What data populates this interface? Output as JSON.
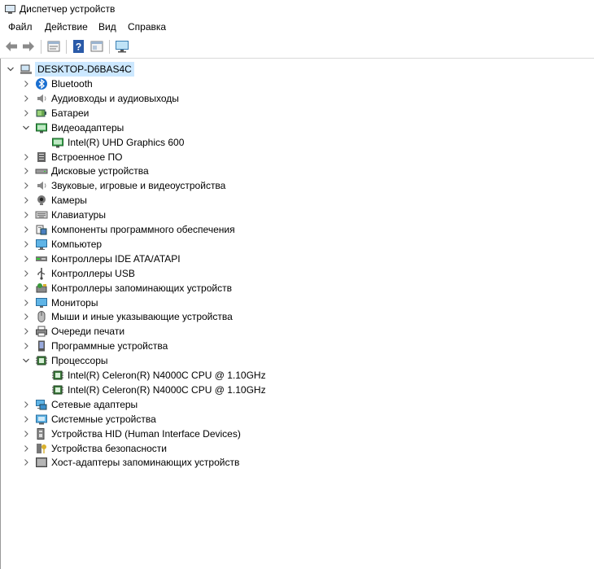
{
  "window": {
    "title": "Диспетчер устройств"
  },
  "menu": {
    "items": [
      "Файл",
      "Действие",
      "Вид",
      "Справка"
    ]
  },
  "toolbar": {
    "buttons": [
      "back-icon",
      "forward-icon",
      "properties-icon",
      "help-icon",
      "console-tree-icon",
      "monitor-scan-icon"
    ]
  },
  "tree": {
    "root": "DESKTOP-D6BAS4C",
    "items": [
      {
        "label": "Bluetooth",
        "icon": "bluetooth-icon",
        "expanded": false
      },
      {
        "label": "Аудиовходы и аудиовыходы",
        "icon": "speaker-icon",
        "expanded": false
      },
      {
        "label": "Батареи",
        "icon": "battery-icon",
        "expanded": false
      },
      {
        "label": "Видеоадаптеры",
        "icon": "display-adapter-icon",
        "expanded": true
      },
      {
        "label": "Intel(R) UHD Graphics 600",
        "icon": "display-adapter-icon",
        "child": true
      },
      {
        "label": "Встроенное ПО",
        "icon": "firmware-icon",
        "expanded": false
      },
      {
        "label": "Дисковые устройства",
        "icon": "disk-icon",
        "expanded": false
      },
      {
        "label": "Звуковые, игровые и видеоустройства",
        "icon": "speaker-icon",
        "expanded": false
      },
      {
        "label": "Камеры",
        "icon": "camera-icon",
        "expanded": false
      },
      {
        "label": "Клавиатуры",
        "icon": "keyboard-icon",
        "expanded": false
      },
      {
        "label": "Компоненты программного обеспечения",
        "icon": "software-component-icon",
        "expanded": false
      },
      {
        "label": "Компьютер",
        "icon": "computer-icon",
        "expanded": false
      },
      {
        "label": "Контроллеры IDE ATA/ATAPI",
        "icon": "ide-controller-icon",
        "expanded": false
      },
      {
        "label": "Контроллеры USB",
        "icon": "usb-icon",
        "expanded": false
      },
      {
        "label": "Контроллеры запоминающих устройств",
        "icon": "storage-controller-icon",
        "expanded": false
      },
      {
        "label": "Мониторы",
        "icon": "monitor-icon",
        "expanded": false
      },
      {
        "label": "Мыши и иные указывающие устройства",
        "icon": "mouse-icon",
        "expanded": false
      },
      {
        "label": "Очереди печати",
        "icon": "printer-icon",
        "expanded": false
      },
      {
        "label": "Программные устройства",
        "icon": "software-device-icon",
        "expanded": false
      },
      {
        "label": "Процессоры",
        "icon": "processor-icon",
        "expanded": true
      },
      {
        "label": "Intel(R) Celeron(R) N4000C CPU @ 1.10GHz",
        "icon": "processor-icon",
        "child": true
      },
      {
        "label": "Intel(R) Celeron(R) N4000C CPU @ 1.10GHz",
        "icon": "processor-icon",
        "child": true
      },
      {
        "label": "Сетевые адаптеры",
        "icon": "network-adapter-icon",
        "expanded": false
      },
      {
        "label": "Системные устройства",
        "icon": "system-devices-icon",
        "expanded": false
      },
      {
        "label": "Устройства HID (Human Interface Devices)",
        "icon": "hid-icon",
        "expanded": false
      },
      {
        "label": "Устройства безопасности",
        "icon": "security-device-icon",
        "expanded": false
      },
      {
        "label": "Хост-адаптеры запоминающих устройств",
        "icon": "storage-host-icon",
        "expanded": false
      }
    ]
  },
  "colors": {
    "selection": "#cce8ff",
    "bluetooth": "#1a6fd0",
    "monitor": "#3aa0e0",
    "processor": "#2e6b2e"
  }
}
